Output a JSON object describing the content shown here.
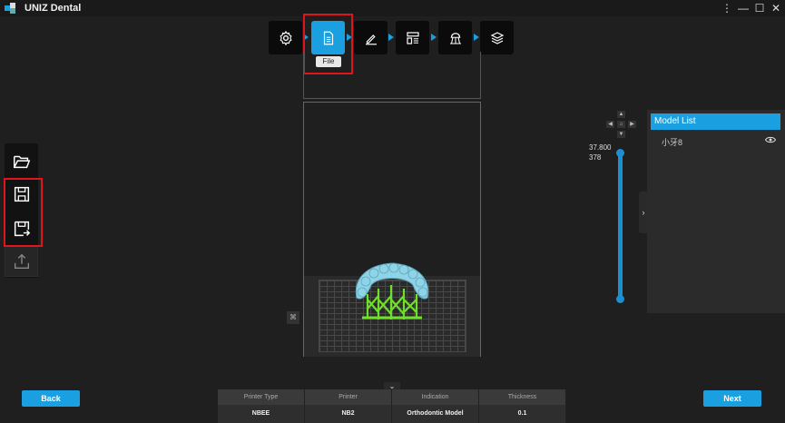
{
  "window": {
    "title": "UNIZ Dental",
    "controls": {
      "menu": "⋮",
      "minimize": "—",
      "maximize": "☐",
      "close": "✕"
    }
  },
  "workflow": {
    "steps": [
      {
        "name": "settings",
        "icon": "gear-icon",
        "active": false
      },
      {
        "name": "file",
        "icon": "document-icon",
        "active": true
      },
      {
        "name": "edit",
        "icon": "pencil-icon",
        "active": false
      },
      {
        "name": "layout",
        "icon": "layout-icon",
        "active": false
      },
      {
        "name": "support",
        "icon": "support-icon",
        "active": false
      },
      {
        "name": "slice",
        "icon": "layers-icon",
        "active": false
      }
    ],
    "tooltip": "File"
  },
  "left_tools": [
    {
      "name": "open",
      "icon": "folder-open-icon"
    },
    {
      "name": "save",
      "icon": "save-icon"
    },
    {
      "name": "save-as",
      "icon": "save-as-icon"
    },
    {
      "name": "export",
      "icon": "upload-icon",
      "disabled": true
    }
  ],
  "layer_slider": {
    "top_value": "37.800",
    "layer_value": "378"
  },
  "model_list": {
    "title": "Model List",
    "items": [
      {
        "label": "小牙8",
        "visible": true
      }
    ]
  },
  "bottom": {
    "back_label": "Back",
    "next_label": "Next",
    "info": [
      {
        "header": "Printer Type",
        "value": "NBEE"
      },
      {
        "header": "Printer",
        "value": "NB2"
      },
      {
        "header": "Indication",
        "value": "Orthodontic Model"
      },
      {
        "header": "Thickness",
        "value": "0.1"
      }
    ]
  },
  "colors": {
    "accent": "#1aa0e0",
    "highlight": "#e0141c",
    "model": "#8fd4e6",
    "support": "#6fe02a"
  }
}
